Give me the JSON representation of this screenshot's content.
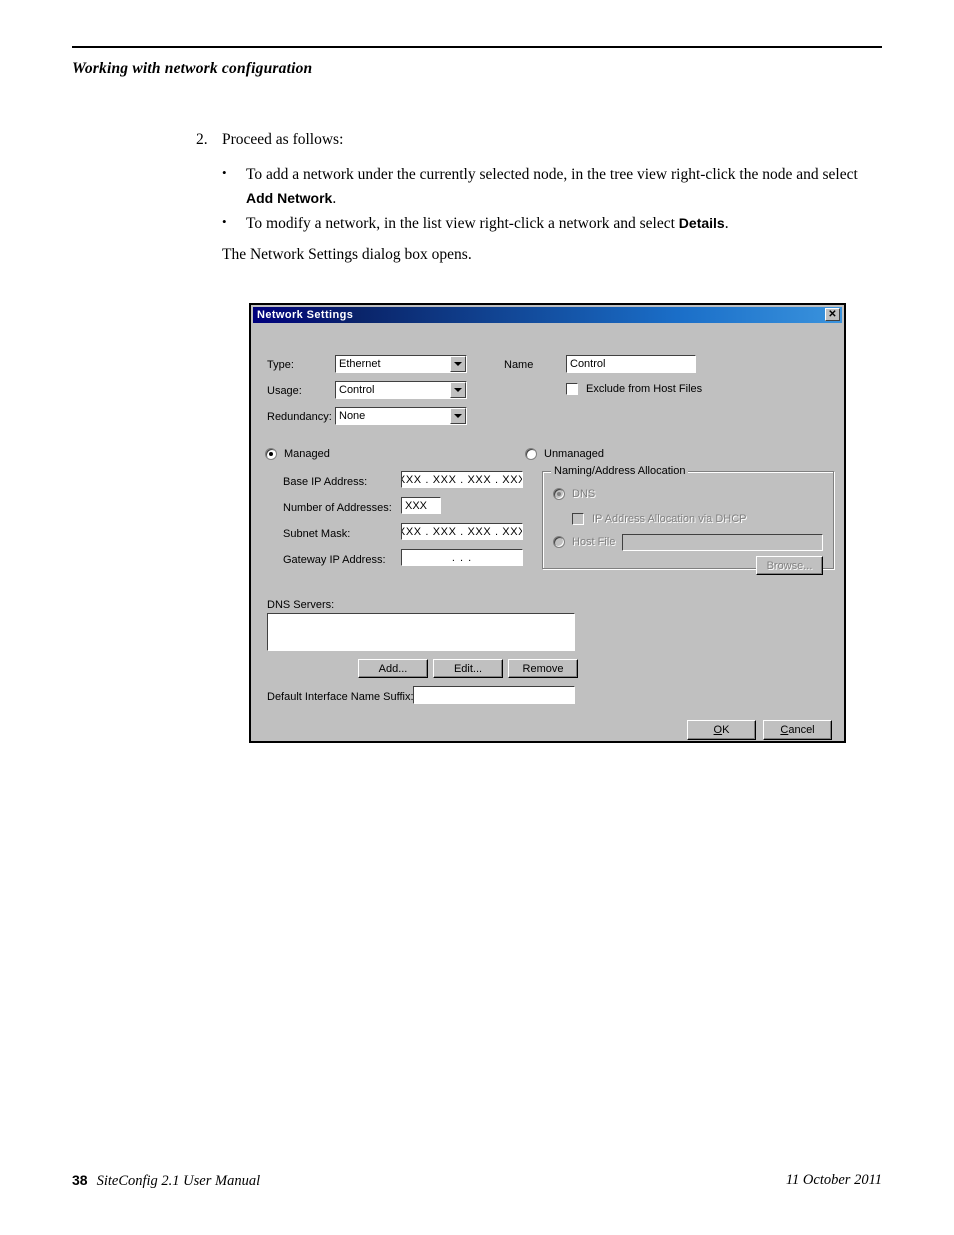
{
  "page": {
    "running_head": "Working with network configuration",
    "footer_page_number": "38",
    "footer_title": "SiteConfig 2.1 User Manual",
    "footer_date": "11 October 2011"
  },
  "body": {
    "step_number": "2.",
    "step_text": "Proceed as follows:",
    "bullet_1_pre": "To add a network under the currently selected node, in the tree view right-click the node and select ",
    "bullet_1_bold": "Add Network",
    "bullet_1_post": ".",
    "bullet_2_pre": "To modify a network, in the list view right-click a network and select ",
    "bullet_2_bold": "Details",
    "bullet_2_post": ".",
    "closing": "The Network Settings dialog box opens.",
    "bullet_glyph": "•"
  },
  "dialog": {
    "title": "Network Settings",
    "close_glyph": "✕",
    "title_bar_color": "#0a246a",
    "face_color": "#c0c0c0",
    "disabled_text_color": "#808080",
    "fields": {
      "type_label": "Type:",
      "type_value": "Ethernet",
      "usage_label": "Usage:",
      "usage_value": "Control",
      "redundancy_label": "Redundancy:",
      "redundancy_value": "None",
      "name_label": "Name",
      "name_value": "Control",
      "exclude_from_host_files_label": "Exclude from Host Files",
      "exclude_from_host_files_checked": false
    },
    "mode": {
      "managed_label": "Managed",
      "managed_selected": true,
      "unmanaged_label": "Unmanaged",
      "unmanaged_selected": false
    },
    "managed_group": {
      "base_ip_label": "Base IP Address:",
      "base_ip_value": "XXX . XXX . XXX . XXX",
      "number_of_addresses_label": "Number of Addresses:",
      "number_of_addresses_value": "XXX",
      "subnet_mask_label": "Subnet Mask:",
      "subnet_mask_value": "XXX . XXX . XXX . XXX",
      "gateway_ip_label": "Gateway IP Address:",
      "gateway_ip_value": ".        .        ."
    },
    "naming_allocation": {
      "group_title": "Naming/Address Allocation",
      "dns_label": "DNS",
      "dns_selected": true,
      "dns_enabled": false,
      "dhcp_label": "IP Address Allocation via DHCP",
      "dhcp_checked": false,
      "dhcp_enabled": false,
      "host_file_label": "Host File",
      "host_file_selected": false,
      "host_file_enabled": false,
      "host_file_value": "",
      "browse_label": "Browse...",
      "browse_enabled": false
    },
    "dns_servers": {
      "label": "DNS Servers:",
      "items": [],
      "add_label": "Add...",
      "edit_label": "Edit...",
      "remove_label": "Remove"
    },
    "suffix": {
      "label": "Default Interface Name Suffix:",
      "value": ""
    },
    "actions": {
      "ok_accel": "O",
      "ok_rest": "K",
      "cancel_accel": "C",
      "cancel_rest": "ancel"
    }
  }
}
